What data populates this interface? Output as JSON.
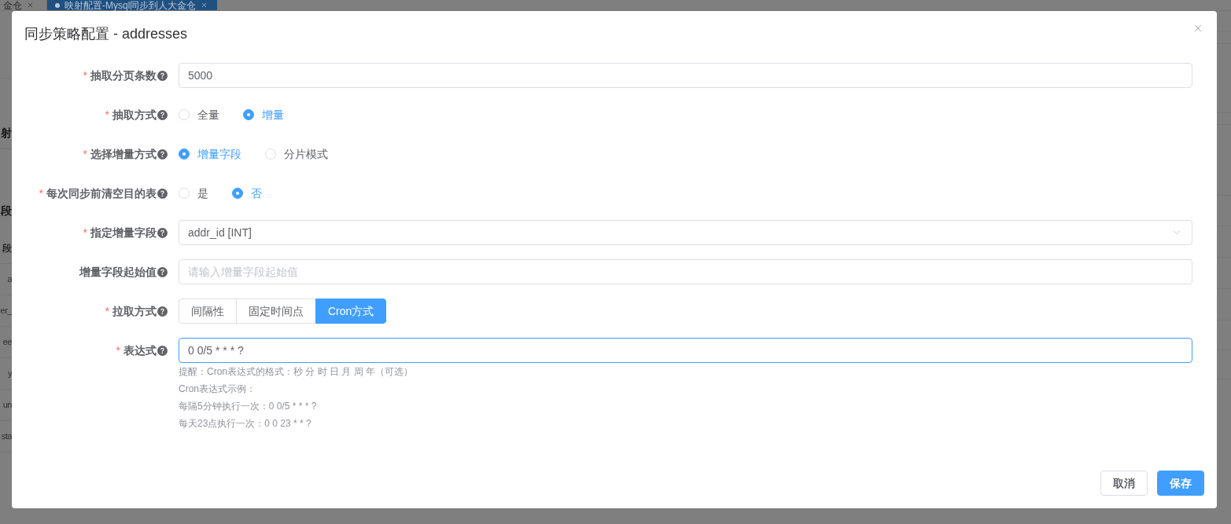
{
  "background": {
    "tabs": [
      {
        "label": "金仓",
        "selected": false
      },
      {
        "label": "映射配置-Mysql同步到人大金仓",
        "selected": true
      }
    ],
    "left_column": [
      {
        "kind": "section-title",
        "text": "射"
      },
      {
        "kind": "subsection-title",
        "text": "段"
      },
      {
        "kind": "column-header",
        "text": "段"
      },
      {
        "kind": "cell",
        "text": "a"
      },
      {
        "kind": "cell",
        "text": "er_"
      },
      {
        "kind": "cell",
        "text": "ee"
      },
      {
        "kind": "cell",
        "text": "y"
      },
      {
        "kind": "cell",
        "text": "un"
      },
      {
        "kind": "cell",
        "text": "sta"
      }
    ]
  },
  "dialog": {
    "title": "同步策略配置 - addresses"
  },
  "form": {
    "rows": [
      {
        "kind": "input",
        "required_mark": "*",
        "label": "抽取分页条数",
        "value": "5000",
        "focused": false
      },
      {
        "kind": "radio",
        "required_mark": "*",
        "label": "抽取方式",
        "options": [
          {
            "label": "全量",
            "selected": false
          },
          {
            "label": "增量",
            "selected": true
          }
        ]
      },
      {
        "kind": "radio",
        "required_mark": "*",
        "label": "选择增量方式",
        "options": [
          {
            "label": "增量字段",
            "selected": true
          },
          {
            "label": "分片模式",
            "selected": false
          }
        ]
      },
      {
        "kind": "radio",
        "required_mark": "*",
        "label": "每次同步前清空目的表",
        "options": [
          {
            "label": "是",
            "selected": false
          },
          {
            "label": "否",
            "selected": true
          }
        ]
      },
      {
        "kind": "select",
        "required_mark": "*",
        "label": "指定增量字段",
        "value": "addr_id [INT]"
      },
      {
        "kind": "input",
        "label": "增量字段起始值",
        "placeholder": "请输入增量字段起始值",
        "focused": false
      },
      {
        "kind": "segmented",
        "required_mark": "*",
        "label": "拉取方式",
        "options": [
          {
            "label": "间隔性",
            "selected": false
          },
          {
            "label": "固定时间点",
            "selected": false
          },
          {
            "label": "Cron方式",
            "selected": true
          }
        ]
      },
      {
        "kind": "input",
        "required_mark": "*",
        "label": "表达式",
        "value": "0 0/5 * * * ?",
        "focused": true,
        "hints": [
          "提醒：Cron表达式的格式：秒 分 时 日 月 周 年（可选）",
          "Cron表达式示例：",
          "每隔5分钟执行一次：0 0/5 * * * ?",
          "每天23点执行一次：0 0 23 * * ?"
        ]
      }
    ]
  },
  "footer": {
    "buttons": [
      {
        "label": "取消",
        "kind": "default"
      },
      {
        "label": "保存",
        "kind": "primary"
      }
    ]
  }
}
